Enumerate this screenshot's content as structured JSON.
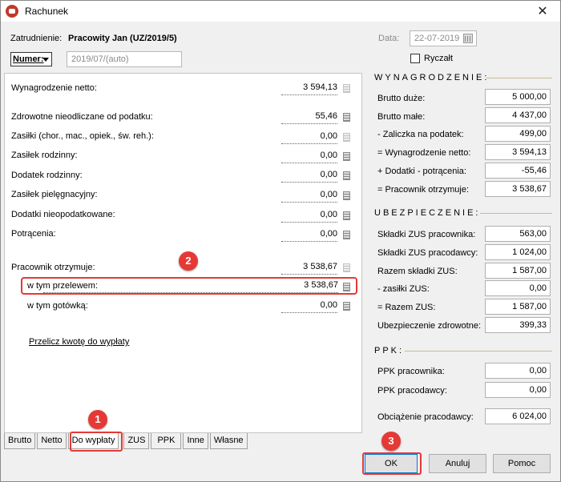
{
  "window": {
    "title": "Rachunek",
    "close_symbol": "✕"
  },
  "header": {
    "employee_label": "Zatrudnienie:",
    "employee_value": "Pracowity Jan  (UZ/2019/5)",
    "date_label": "Data:",
    "date_value": "22-07-2019",
    "numer_label": "Numer:",
    "numer_value": "2019/07/(auto)",
    "ryczalt_label": "Ryczałt"
  },
  "left": {
    "rows": [
      {
        "label": "Wynagrodzenie netto:",
        "value": "3 594,13"
      },
      {
        "label": "Zdrowotne nieodliczane od podatku:",
        "value": "55,46"
      },
      {
        "label": "Zasiłki (chor., mac., opiek., św. reh.):",
        "value": "0,00"
      },
      {
        "label": "Zasiłek rodzinny:",
        "value": "0,00"
      },
      {
        "label": "Dodatek rodzinny:",
        "value": "0,00"
      },
      {
        "label": "Zasiłek pielęgnacyjny:",
        "value": "0,00"
      },
      {
        "label": "Dodatki nieopodatkowane:",
        "value": "0,00"
      },
      {
        "label": "Potrącenia:",
        "value": "0,00"
      },
      {
        "label": "Pracownik otrzymuje:",
        "value": "3 538,67"
      },
      {
        "label": "w tym przelewem:",
        "value": "3 538,67"
      },
      {
        "label": "w tym gotówką:",
        "value": "0,00"
      }
    ],
    "link": "Przelicz kwotę do wypłaty"
  },
  "right": {
    "section_wynagrodzenie": "WYNAGRODZENIE:",
    "wyn_rows": [
      {
        "label": "Brutto duże:",
        "value": "5 000,00"
      },
      {
        "label": "Brutto małe:",
        "value": "4 437,00"
      },
      {
        "label": "-  Zaliczka na podatek:",
        "value": "499,00"
      },
      {
        "label": "= Wynagrodzenie netto:",
        "value": "3 594,13"
      },
      {
        "label": "+ Dodatki - potrącenia:",
        "value": "-55,46"
      },
      {
        "label": "= Pracownik otrzymuje:",
        "value": "3 538,67"
      }
    ],
    "section_ubezpieczenie": "UBEZPIECZENIE:",
    "ub_rows": [
      {
        "label": "Składki ZUS pracownika:",
        "value": "563,00"
      },
      {
        "label": "Składki ZUS pracodawcy:",
        "value": "1 024,00"
      },
      {
        "label": "Razem składki ZUS:",
        "value": "1 587,00"
      },
      {
        "label": "-  zasiłki ZUS:",
        "value": "0,00"
      },
      {
        "label": "= Razem ZUS:",
        "value": "1 587,00"
      },
      {
        "label": "Ubezpieczenie zdrowotne:",
        "value": "399,33"
      }
    ],
    "section_ppk": "PPK:",
    "ppk_rows": [
      {
        "label": "PPK pracownika:",
        "value": "0,00"
      },
      {
        "label": "PPK pracodawcy:",
        "value": "0,00"
      }
    ],
    "obciazenie": {
      "label": "Obciążenie pracodawcy:",
      "value": "6 024,00"
    }
  },
  "tabs": [
    "Brutto",
    "Netto",
    "Do wypłaty",
    "ZUS",
    "PPK",
    "Inne",
    "Własne"
  ],
  "active_tab": "Do wypłaty",
  "buttons": {
    "ok": "OK",
    "cancel": "Anuluj",
    "help": "Pomoc"
  },
  "badges": [
    "1",
    "2",
    "3"
  ],
  "colors": {
    "highlight": "#e53935",
    "section_line": "#c9b99a"
  }
}
